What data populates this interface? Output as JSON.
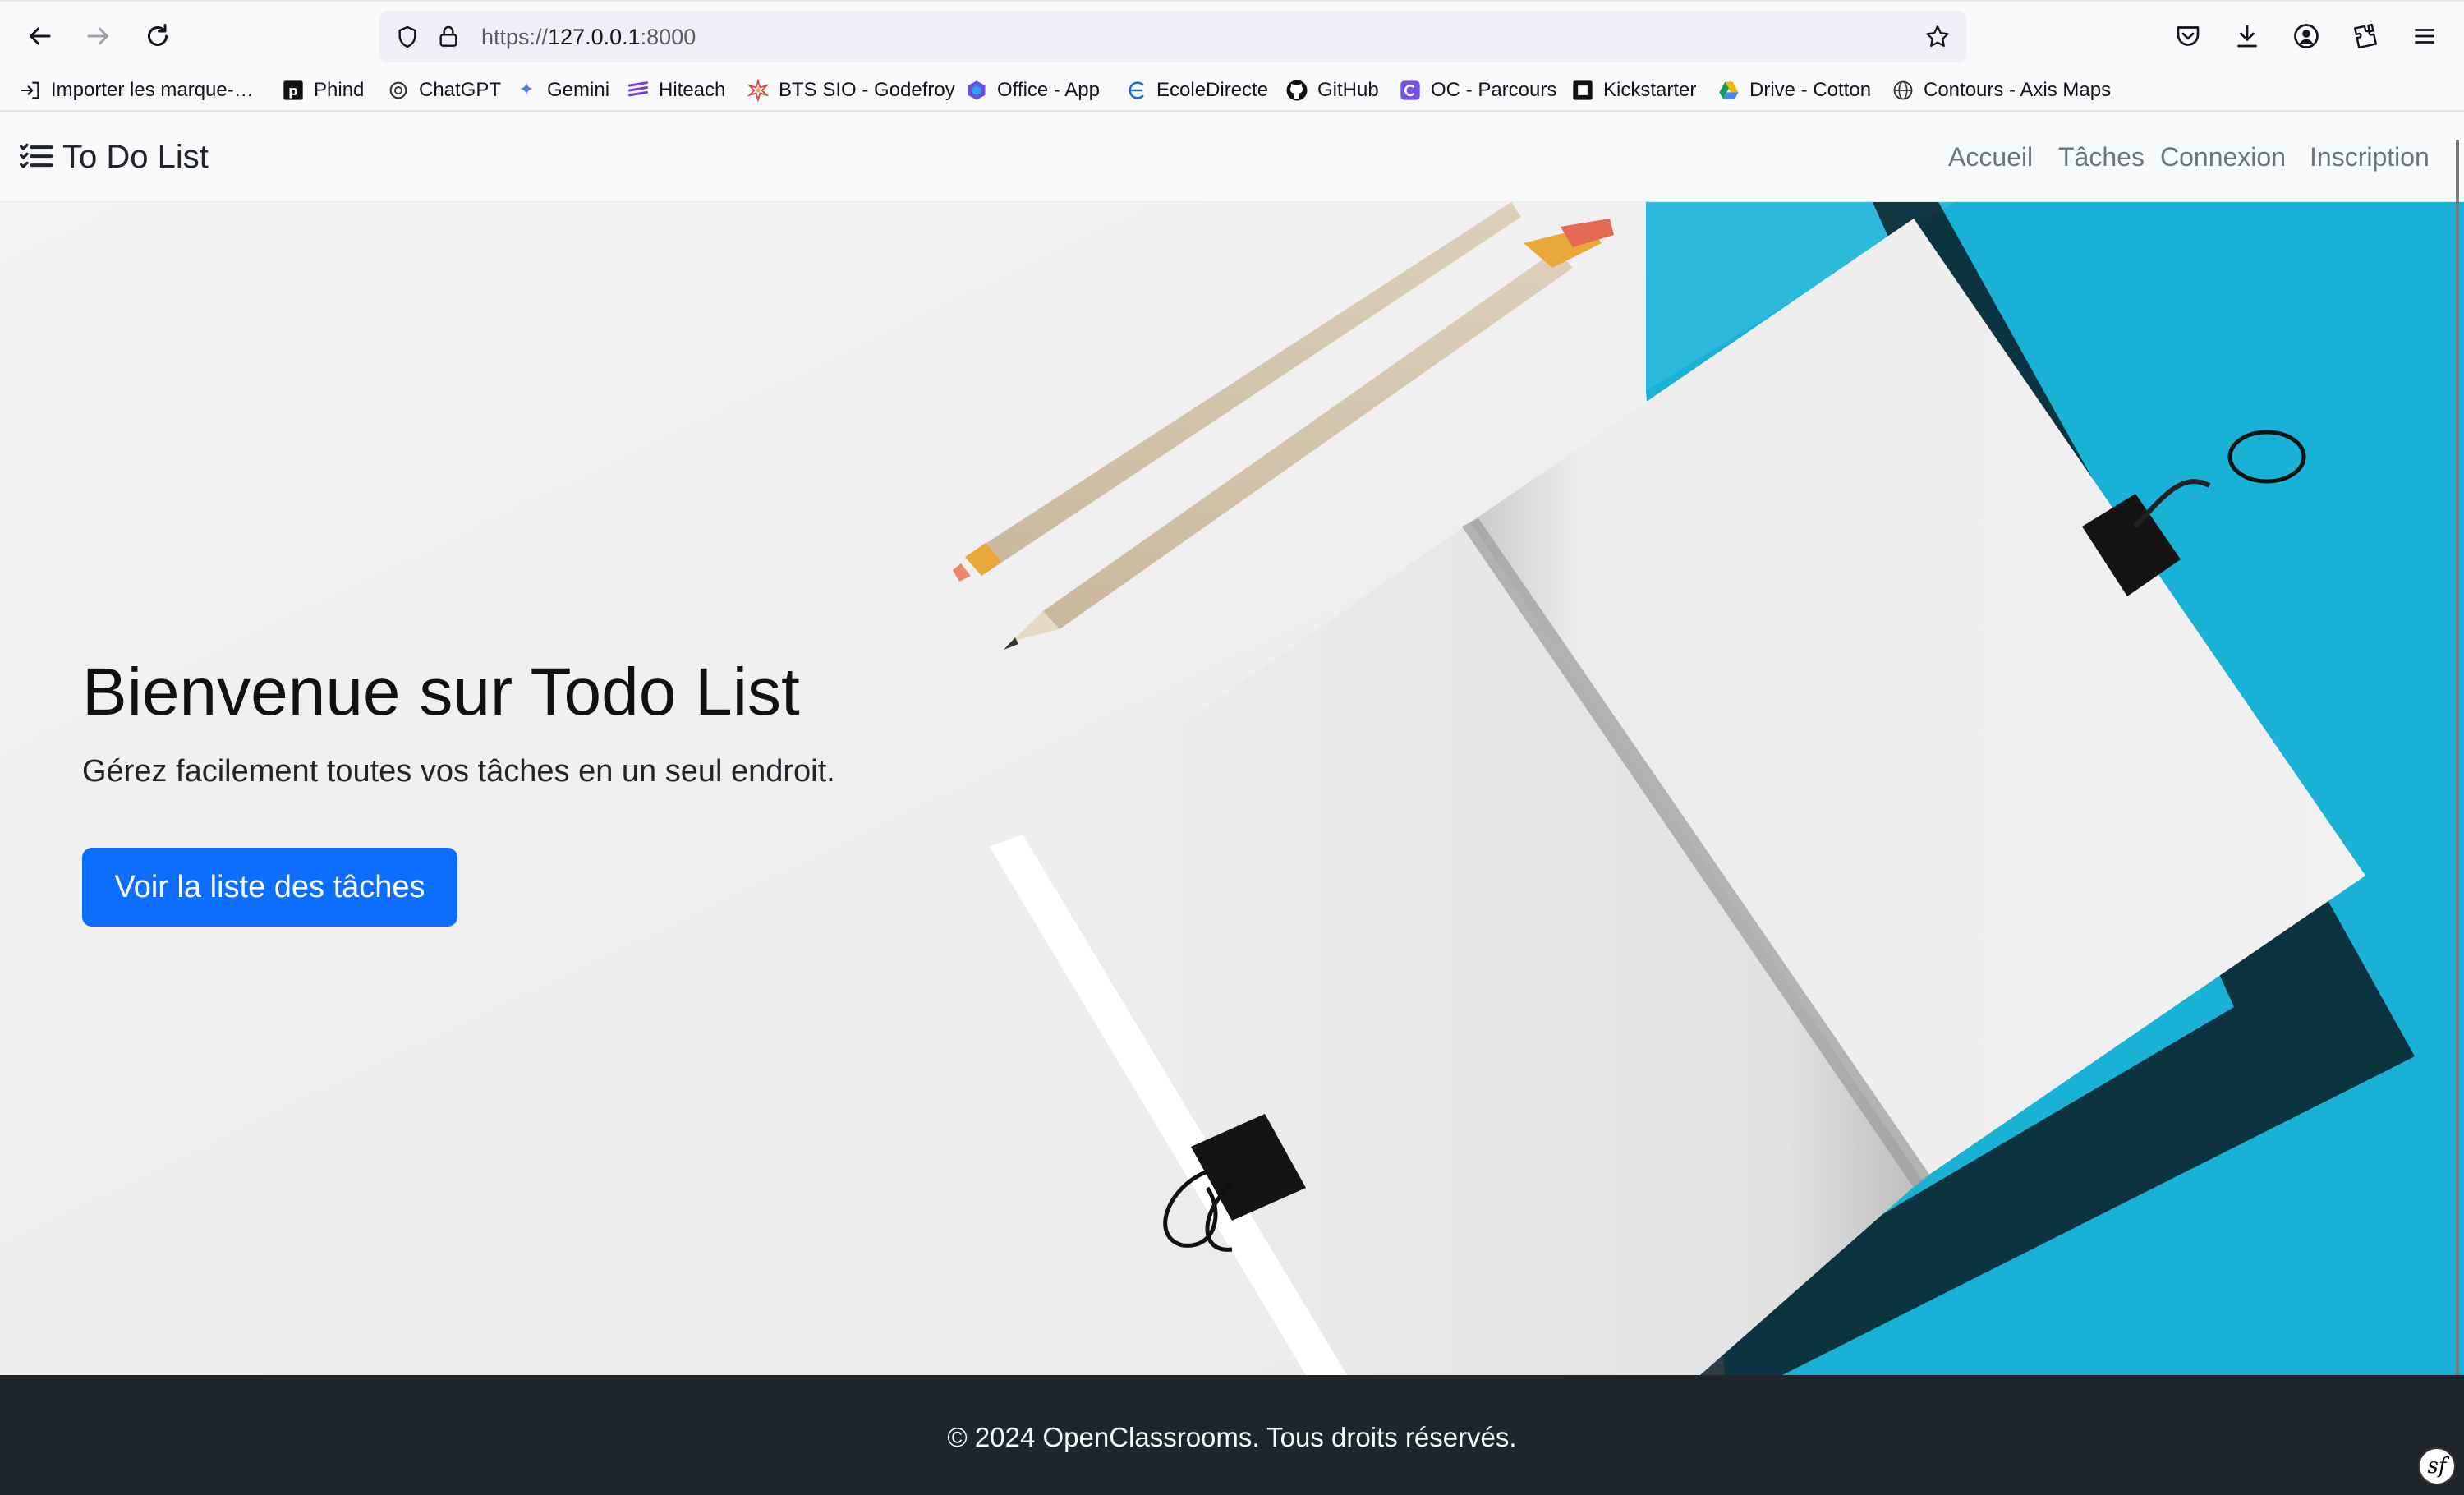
{
  "browser": {
    "url_scheme": "https://",
    "url_host": "127.0.0.1",
    "url_port": ":8000",
    "icons": [
      "back-icon",
      "forward-icon",
      "reload-icon",
      "shield-icon",
      "lock-icon",
      "star-icon",
      "pocket-icon",
      "download-icon",
      "account-icon",
      "extensions-icon",
      "menu-icon"
    ]
  },
  "bookmarks": [
    {
      "label": "Importer les marque-…",
      "icon": "import-icon"
    },
    {
      "label": "Phind",
      "icon": "phind-icon"
    },
    {
      "label": "ChatGPT",
      "icon": "chatgpt-icon"
    },
    {
      "label": "Gemini",
      "icon": "gemini-icon"
    },
    {
      "label": "Hiteach",
      "icon": "hiteach-icon"
    },
    {
      "label": "BTS SIO - Godefroy",
      "icon": "star-burst-icon"
    },
    {
      "label": "Office - App",
      "icon": "office-icon"
    },
    {
      "label": "EcoleDirecte",
      "icon": "ecoledirecte-icon"
    },
    {
      "label": "GitHub",
      "icon": "github-icon"
    },
    {
      "label": "OC - Parcours",
      "icon": "openclassrooms-icon"
    },
    {
      "label": "Kickstarter",
      "icon": "kickstarter-icon"
    },
    {
      "label": "Drive - Cotton",
      "icon": "google-drive-icon"
    },
    {
      "label": "Contours - Axis Maps",
      "icon": "globe-icon"
    }
  ],
  "navbar": {
    "brand": "To Do List",
    "links": [
      "Accueil",
      "Tâches",
      "Connexion",
      "Inscription"
    ]
  },
  "hero": {
    "title": "Bienvenue sur Todo List",
    "subtitle": "Gérez facilement toutes vos tâches en un seul endroit.",
    "button": "Voir la liste des tâches"
  },
  "footer": {
    "text": "© 2024 OpenClassrooms. Tous droits réservés.",
    "badge": "sf"
  },
  "colors": {
    "primary": "#0d6efd",
    "footer_bg": "#212529",
    "navbar_bg": "#f8f9fa",
    "accent_cyan": "#1ab1d6"
  }
}
